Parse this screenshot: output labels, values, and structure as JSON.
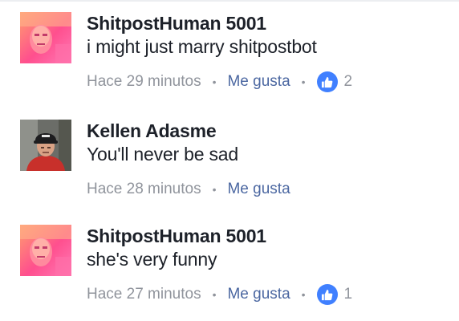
{
  "comments": [
    {
      "author": "ShitpostHuman 5001",
      "text": "i might just marry shitpostbot",
      "time": "Hace 29 minutos",
      "like_label": "Me gusta",
      "like_count": "2",
      "avatar_icon": "avatar-pink-face-icon"
    },
    {
      "author": "Kellen Adasme",
      "text": "You'll never be sad",
      "time": "Hace 28 minutos",
      "like_label": "Me gusta",
      "avatar_icon": "avatar-man-cap-icon"
    },
    {
      "author": "ShitpostHuman 5001",
      "text": "she's very funny",
      "time": "Hace 27 minutos",
      "like_label": "Me gusta",
      "like_count": "1",
      "avatar_icon": "avatar-pink-face-icon"
    }
  ],
  "separator": "•",
  "colors": {
    "author": "#1d2129",
    "meta_gray": "#90949c",
    "link_blue": "#4b67a1",
    "like_badge": "#4080ff"
  }
}
